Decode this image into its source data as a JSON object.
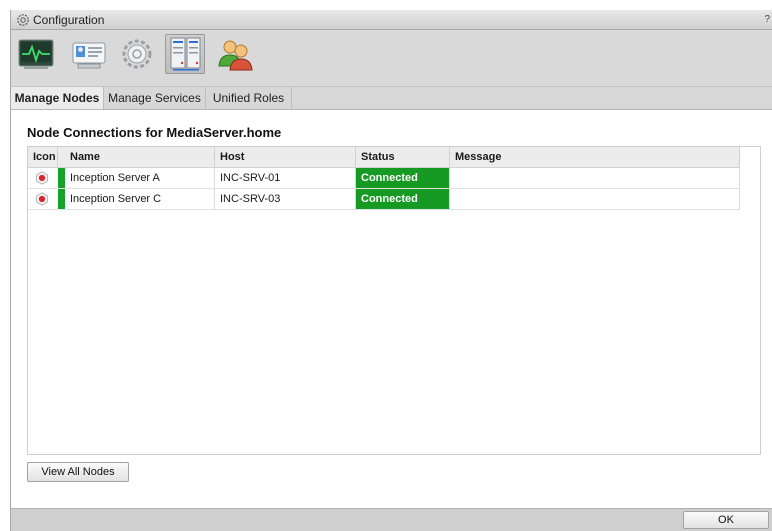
{
  "window": {
    "title": "Configuration",
    "help": "?"
  },
  "toolbar": {
    "icons": [
      "activity-monitor-icon",
      "id-card-icon",
      "settings-gears-icon",
      "server-rack-icon",
      "users-icon"
    ],
    "selected": "server-rack-icon"
  },
  "tabs": [
    {
      "label": "Manage Nodes",
      "active": true
    },
    {
      "label": "Manage Services",
      "active": false
    },
    {
      "label": "Unified Roles",
      "active": false
    }
  ],
  "section": {
    "title": "Node Connections for MediaServer.home"
  },
  "table": {
    "columns": [
      "Icon",
      "Name",
      "Host",
      "Status",
      "Message"
    ],
    "rows": [
      {
        "icon": "node-hex-icon",
        "name": "Inception Server A",
        "host": "INC-SRV-01",
        "status": "Connected",
        "message": ""
      },
      {
        "icon": "node-hex-icon",
        "name": "Inception Server C",
        "host": "INC-SRV-03",
        "status": "Connected",
        "message": ""
      }
    ]
  },
  "buttons": {
    "view_all": "View All Nodes",
    "ok": "OK"
  },
  "colors": {
    "status_connected": "#169a24",
    "indicator": "#16a12a"
  }
}
